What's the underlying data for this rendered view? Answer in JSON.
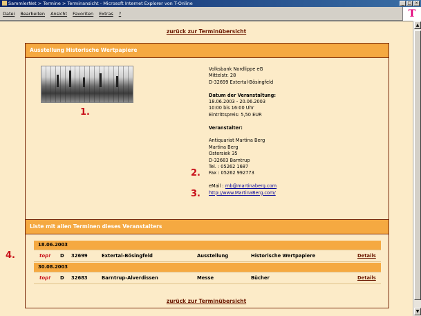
{
  "window": {
    "title": "SammlerNet > Termine > Terminansicht - Microsoft Internet Explorer von T-Online",
    "buttons": [
      "_",
      "□",
      "×"
    ]
  },
  "menu": [
    "Datei",
    "Bearbeiten",
    "Ansicht",
    "Favoriten",
    "Extras",
    "?"
  ],
  "brand_logo": "T",
  "page": {
    "back_link": "zurück zur Terminübersicht",
    "section_title": "Ausstellung Historische Wertpapiere",
    "markers": {
      "m1": "1.",
      "m2": "2.",
      "m3": "3.",
      "m4": "4."
    },
    "location": {
      "name": "Volksbank Nordlippe eG",
      "street": "Mittelstr. 28",
      "city": "D-32699 Extertal-Bösingfeld"
    },
    "date_heading": "Datum der Veranstaltung:",
    "date_range": "18.06.2003 - 20.06.2003",
    "time": "10:00 bis 16:00 Uhr",
    "fee": "Eintrittspreis: 5,50 EUR",
    "organizer_heading": "Veranstalter:",
    "organizer": {
      "company": "Antiquariat Martina Berg",
      "person": "Martina Berg",
      "street": "Ostersiek 35",
      "city": "D-32683 Barntrup",
      "tel": "Tel. : 05262 1687",
      "fax": "Fax : 05262 992773",
      "email_label": "eMail :",
      "email": "mb@martinaberg.com",
      "website": "http://www.MartinaBerg.com/"
    },
    "list_title": "Liste mit allen Terminen dieses Veranstalters",
    "events": [
      {
        "date": "18.06.2003",
        "badge": "top!",
        "country": "D",
        "zip": "32699",
        "city": "Extertal-Bösingfeld",
        "type": "Ausstellung",
        "topic": "Historische Wertpapiere",
        "details": "Details"
      },
      {
        "date": "30.08.2003",
        "badge": "top!",
        "country": "D",
        "zip": "32683",
        "city": "Barntrup-Alverdissen",
        "type": "Messe",
        "topic": "Bücher",
        "details": "Details"
      }
    ]
  },
  "colors": {
    "accent": "#f5a941",
    "background": "#fcebc8",
    "border": "#7a2a0c",
    "marker": "#c8101a",
    "link": "#00009c"
  }
}
